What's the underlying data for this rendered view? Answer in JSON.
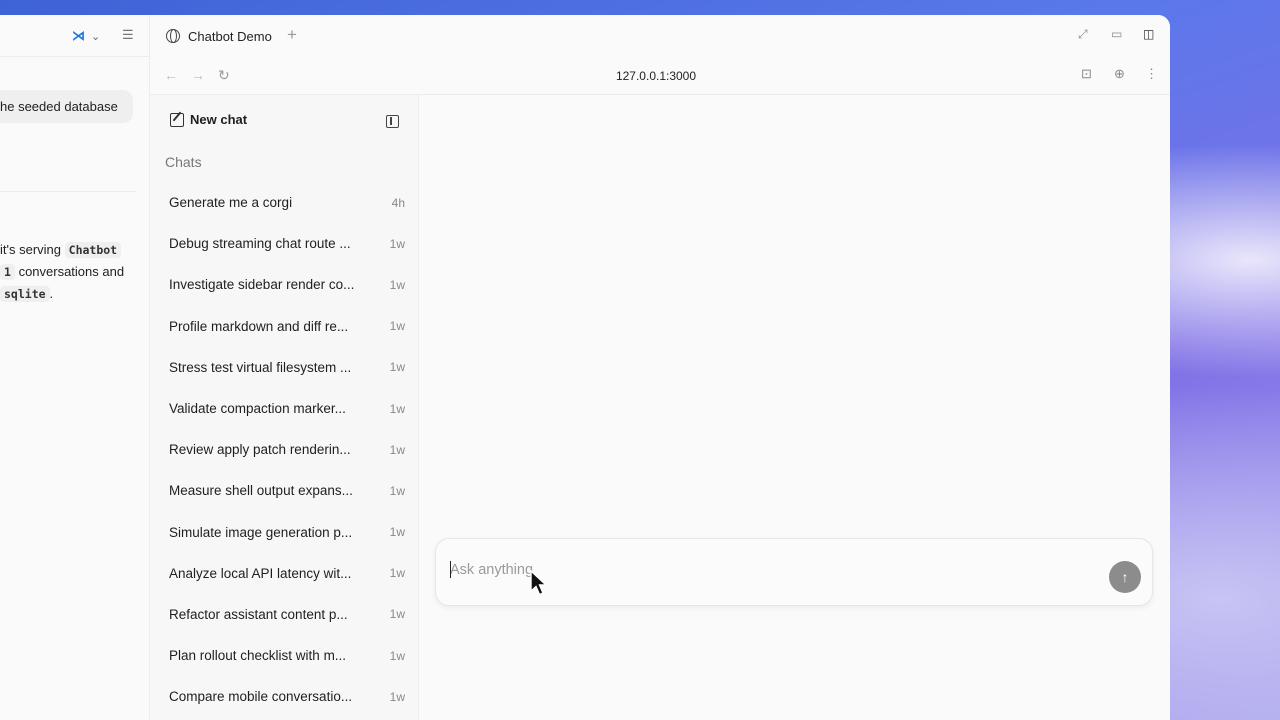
{
  "ide_panel": {
    "message_bubble": "he seeded database",
    "reply_line1_prefix": "it's serving",
    "reply_line1_code": "Chatbot",
    "reply_line2_code": "1",
    "reply_line2_text": "conversations and",
    "reply_line3_code": "sqlite",
    "reply_line3_text": "."
  },
  "browser": {
    "tab_title": "Chatbot Demo",
    "url": "127.0.0.1:3000"
  },
  "sidebar": {
    "new_chat_label": "New chat",
    "chats_heading": "Chats",
    "chats": [
      {
        "title": "Generate me a corgi",
        "age": "4h"
      },
      {
        "title": "Debug streaming chat route ...",
        "age": "1w"
      },
      {
        "title": "Investigate sidebar render co...",
        "age": "1w"
      },
      {
        "title": "Profile markdown and diff re...",
        "age": "1w"
      },
      {
        "title": "Stress test virtual filesystem ...",
        "age": "1w"
      },
      {
        "title": "Validate compaction marker...",
        "age": "1w"
      },
      {
        "title": "Review apply patch renderin...",
        "age": "1w"
      },
      {
        "title": "Measure shell output expans...",
        "age": "1w"
      },
      {
        "title": "Simulate image generation p...",
        "age": "1w"
      },
      {
        "title": "Analyze local API latency wit...",
        "age": "1w"
      },
      {
        "title": "Refactor assistant content p...",
        "age": "1w"
      },
      {
        "title": "Plan rollout checklist with m...",
        "age": "1w"
      },
      {
        "title": "Compare mobile conversatio...",
        "age": "1w"
      }
    ]
  },
  "composer": {
    "placeholder": "Ask anything",
    "value": ""
  },
  "icons": {
    "send": "arrow-up-icon",
    "new_chat": "pencil-square-icon",
    "collapse": "sidebar-collapse-icon"
  },
  "colors": {
    "ide_accent": "#1e78d8",
    "send_button": "#8c8c8c"
  }
}
